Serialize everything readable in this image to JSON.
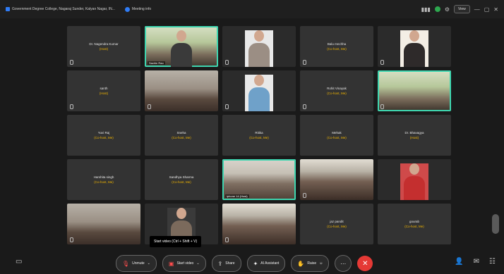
{
  "topbar": {
    "org": "Government Degree College, Nagaraj Sunder, Kalyan Nagar, IN...",
    "meeting": "Meeting info",
    "view": "View"
  },
  "tiles": [
    {
      "name": "Dr. Nagendra Kumar",
      "status": "(Host)"
    },
    {
      "video": true,
      "label": "Sachin Rao"
    },
    {
      "video": true,
      "label": ""
    },
    {
      "name": "Balu mnchha",
      "status": "(Co-host, Me)"
    },
    {
      "video": true,
      "label": ""
    },
    {
      "name": "santh",
      "status": "(Host)"
    },
    {
      "video": true,
      "label": ""
    },
    {
      "video": true,
      "label": ""
    },
    {
      "name": "Rohit Vinayak",
      "status": "(Co-host, Me)"
    },
    {
      "video": true,
      "label": ""
    },
    {
      "name": "Yuvi Raj",
      "status": "(Co-host, Me)"
    },
    {
      "name": "Sneha",
      "status": "(Co-host, Me)"
    },
    {
      "name": "Ritika",
      "status": "(Co-host, Me)"
    },
    {
      "name": "Mehak",
      "status": "(Co-host, Me)"
    },
    {
      "name": "Dr. Bhavagya",
      "status": "(Host)"
    },
    {
      "name": "Harshita singh",
      "status": "(Co-host, Me)"
    },
    {
      "name": "Sandhya Sharma",
      "status": "(Co-host, Me)"
    },
    {
      "video": true,
      "label": "iphone 14 (Host)"
    },
    {
      "video": true,
      "label": ""
    },
    {
      "video": true,
      "label": ""
    },
    {
      "video": true,
      "label": ""
    },
    {
      "video": true,
      "label": ""
    },
    {
      "video": true,
      "label": ""
    },
    {
      "name": "jaz pandit",
      "status": "(Co-host, Me)"
    },
    {
      "name": "gourab",
      "status": "(Co-host, Me)"
    }
  ],
  "tooltip": "Start video (Ctrl + Shift + V)",
  "toolbar": {
    "unmute": "Unmute",
    "start_video": "Start video",
    "share": "Share",
    "ai_assistant": "AI Assistant",
    "raise": "Raise",
    "end": "✕"
  }
}
